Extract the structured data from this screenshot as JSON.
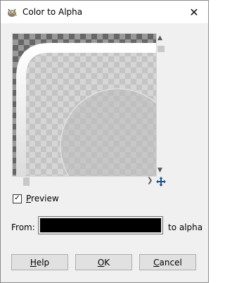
{
  "window": {
    "title": "Color to Alpha",
    "close_glyph": "✕",
    "icon": "gimp-wilber-icon"
  },
  "preview": {
    "checkbox_label_underlined": "P",
    "checkbox_label_rest": "review",
    "checked": true,
    "check_glyph": "✓",
    "scroll_up_glyph": "▲",
    "scroll_down_glyph": "▼",
    "scroll_right_glyph": "❯"
  },
  "color": {
    "from_label": "From:",
    "to_label": "to alpha",
    "value": "#000000"
  },
  "buttons": {
    "help_underlined": "H",
    "help_rest": "elp",
    "ok_underlined": "O",
    "ok_rest": "K",
    "cancel_underlined": "C",
    "cancel_rest": "ancel"
  },
  "colors": {
    "checker_dark": "#666666",
    "checker_light": "#999999",
    "face": "#f0f0f0"
  }
}
